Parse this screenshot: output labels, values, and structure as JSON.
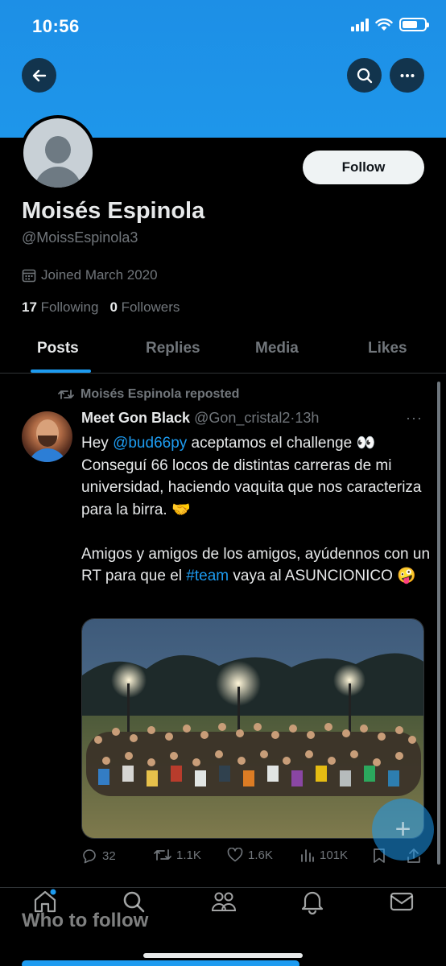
{
  "status_bar": {
    "time": "10:56"
  },
  "header": {
    "back_icon": "arrow-left-icon",
    "search_icon": "search-icon",
    "more_icon": "more-horizontal-icon"
  },
  "profile": {
    "name": "Moisés Espinola",
    "handle": "@MoissEspinola3",
    "follow_label": "Follow",
    "joined": "Joined March 2020",
    "following_count": "17",
    "following_label": "Following",
    "followers_count": "0",
    "followers_label": "Followers"
  },
  "tabs": [
    {
      "label": "Posts",
      "active": true
    },
    {
      "label": "Replies"
    },
    {
      "label": "Media"
    },
    {
      "label": "Likes"
    }
  ],
  "tweet": {
    "repost_label": "Moisés Espinola reposted",
    "author_name": "Meet Gon Black",
    "author_handle": "@Gon_cristal2",
    "separator": "·",
    "time": "13h",
    "more": "···",
    "text_hey": "Hey ",
    "mention": "@bud66py",
    "text_line1_rest": " aceptamos el challenge 👀",
    "text_line2": "Conseguí 66 locos de distintas carreras de mi universidad, haciendo vaquita que nos caracteriza para la birra. 🤝",
    "text_line3_pre": "Amigos y amigos de los amigos, ayúdennos con un RT para que el ",
    "hashtag": "#team",
    "text_line3_post": " vaya al ASUNCIONICO 🤪",
    "replies": "32",
    "retweets": "1.1K",
    "likes": "1.6K",
    "views": "101K"
  },
  "fab_label": "+",
  "bottom_nav": {
    "items": [
      "home-icon",
      "search-icon",
      "communities-icon",
      "notifications-icon",
      "messages-icon"
    ]
  },
  "who_to_follow": "Who to follow",
  "colors": {
    "banner": "#1d93e8",
    "accent": "#1d9bf0",
    "background": "#000000",
    "secondary_text": "#71767b"
  }
}
